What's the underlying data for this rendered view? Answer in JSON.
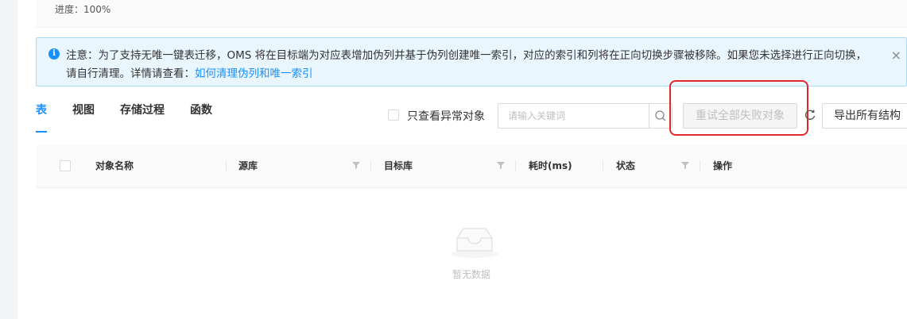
{
  "progress": {
    "text": "进度：100%"
  },
  "notice": {
    "text": "注意：为了支持无唯一键表迁移，OMS 将在目标端为对应表增加伪列并基于伪列创建唯一索引，对应的索引和列将在正向切换步骤被移除。如果您未选择进行正向切换，请自行清理。详情请查看：",
    "link": "如何清理伪列和唯一索引",
    "close": "×"
  },
  "tabs": [
    {
      "label": "表",
      "active": true
    },
    {
      "label": "视图",
      "active": false
    },
    {
      "label": "存储过程",
      "active": false
    },
    {
      "label": "函数",
      "active": false
    }
  ],
  "toolbar": {
    "abnormal_only": "只查看异常对象",
    "search_placeholder": "请输入关键词",
    "retry_all": "重试全部失败对象",
    "export_all": "导出所有结构"
  },
  "table": {
    "columns": [
      "对象名称",
      "源库",
      "目标库",
      "耗时(ms)",
      "状态",
      "操作"
    ],
    "rows": [],
    "empty_text": "暂无数据"
  },
  "colors": {
    "accent": "#1890ff",
    "highlight": "#e5272b",
    "notice_bg": "#e9f6fd"
  }
}
